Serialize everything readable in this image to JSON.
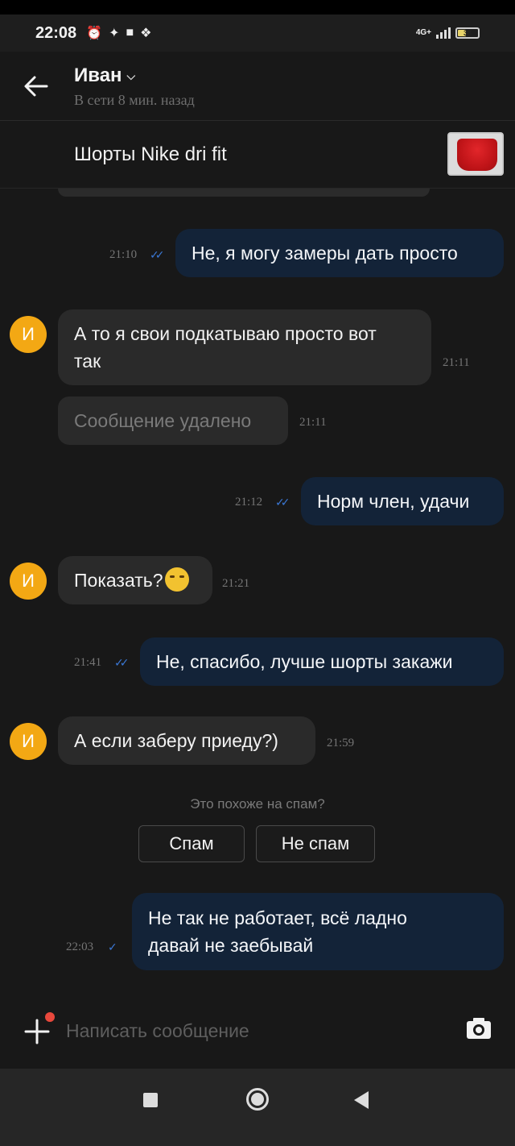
{
  "status_bar": {
    "time": "22:08",
    "network": "4G+",
    "battery": "38"
  },
  "header": {
    "contact_name": "Иван",
    "contact_status": "В сети 8 мин. назад"
  },
  "product": {
    "title": "Шорты Nike dri fit"
  },
  "avatar_initial": "И",
  "messages": [
    {
      "text": "Не, я могу замеры дать просто",
      "time": "21:10"
    },
    {
      "text_line1": "А то я свои подкатываю просто вот",
      "text_line2": "так",
      "time": "21:11"
    },
    {
      "text": "Сообщение удалено",
      "time": "21:11"
    },
    {
      "text": "Норм член, удачи",
      "time": "21:12"
    },
    {
      "text": "Показать?",
      "time": "21:21"
    },
    {
      "text": "Не, спасибо, лучше шорты закажи",
      "time": "21:41"
    },
    {
      "text": "А если заберу приеду?)",
      "time": "21:59"
    },
    {
      "text_line1": "Не так не работает, всё ладно",
      "text_line2": "давай не заебывай",
      "time": "22:03"
    }
  ],
  "spam": {
    "question": "Это похоже на спам?",
    "spam_label": "Спам",
    "not_spam_label": "Не спам"
  },
  "composer": {
    "placeholder": "Написать сообщение"
  },
  "colors": {
    "outgoing": "#132338",
    "incoming": "#2a2a2a",
    "avatar": "#f3a814",
    "read_tick": "#3b78d6"
  }
}
